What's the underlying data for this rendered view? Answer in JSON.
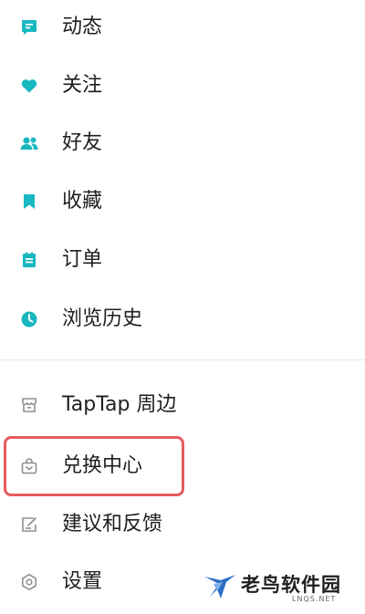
{
  "colors": {
    "accent": "#19b8c0",
    "muted_icon": "#8f8f8f",
    "highlight_border": "#e85a5e"
  },
  "menu": {
    "primary_items": [
      {
        "label": "动态",
        "icon": "message-square-icon"
      },
      {
        "label": "关注",
        "icon": "heart-icon"
      },
      {
        "label": "好友",
        "icon": "friends-icon"
      },
      {
        "label": "收藏",
        "icon": "bookmark-icon"
      },
      {
        "label": "订单",
        "icon": "order-icon"
      },
      {
        "label": "浏览历史",
        "icon": "clock-icon"
      }
    ],
    "secondary_items": [
      {
        "label": "TapTap 周边",
        "icon": "store-icon"
      },
      {
        "label": "兑换中心",
        "icon": "exchange-bag-icon",
        "highlighted": true
      },
      {
        "label": "建议和反馈",
        "icon": "feedback-icon"
      },
      {
        "label": "设置",
        "icon": "settings-icon"
      }
    ]
  },
  "watermark": {
    "title": "老鸟软件园",
    "subtitle": "LNQS.NET",
    "icon": "bird-logo-icon"
  }
}
